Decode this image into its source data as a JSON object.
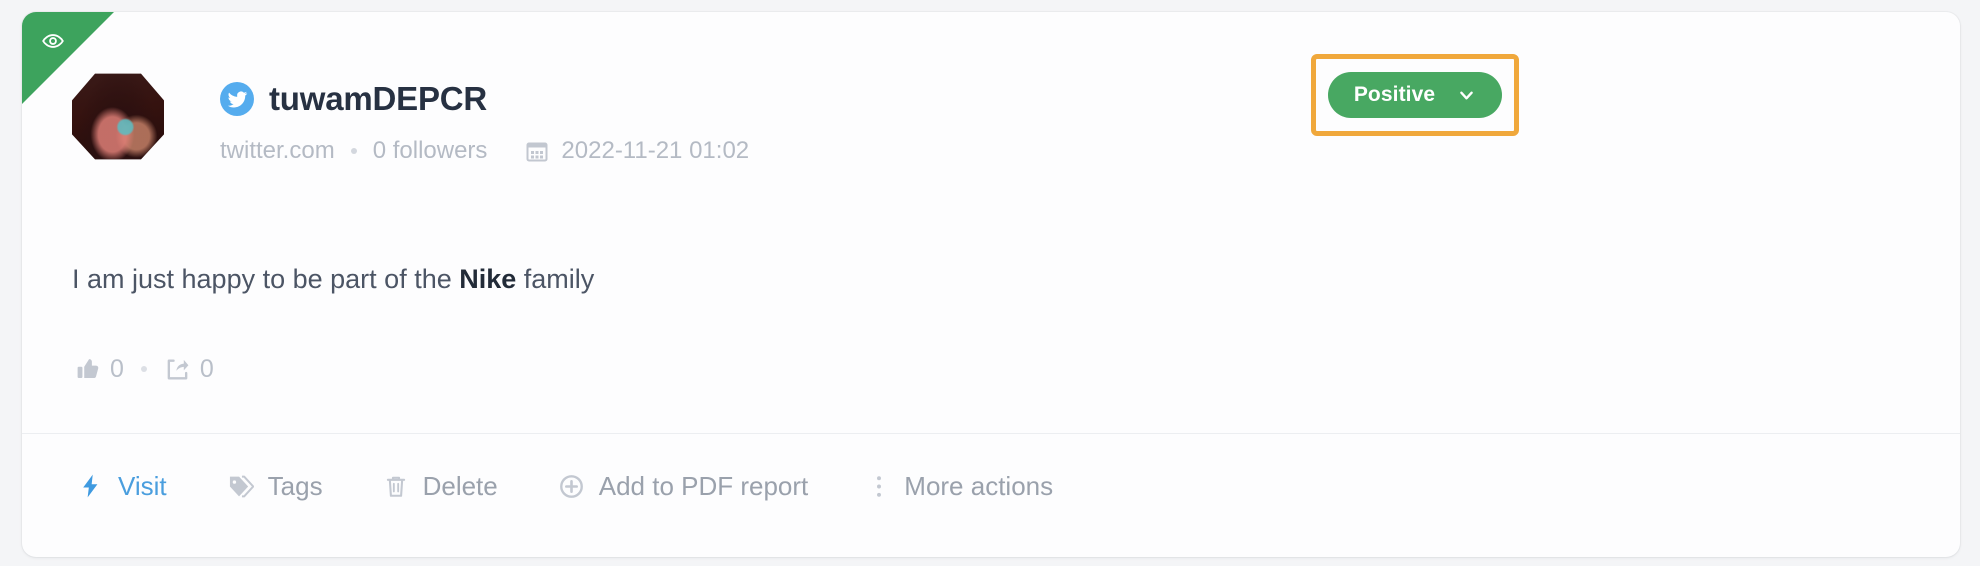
{
  "card": {
    "ribbon": {
      "icon": "eye-icon",
      "color": "#3da35d"
    },
    "author": {
      "username": "tuwamDEPCR",
      "network_icon": "twitter-icon",
      "domain": "twitter.com",
      "followers": "0 followers",
      "date_icon": "calendar-icon",
      "date": "2022-11-21 01:02"
    },
    "sentiment": {
      "label": "Positive",
      "color": "#48a862",
      "chevron_icon": "chevron-down-icon",
      "highlight_color": "#f0a83c"
    },
    "content": {
      "text_before": "I am just happy to be part of the ",
      "highlighted": "Nike",
      "text_after": " family"
    },
    "stats": [
      {
        "icon": "thumbs-up-icon",
        "value": "0"
      },
      {
        "icon": "share-icon",
        "value": "0"
      }
    ],
    "actions": [
      {
        "icon": "lightning-icon",
        "label": "Visit",
        "primary": true
      },
      {
        "icon": "tag-icon",
        "label": "Tags",
        "primary": false
      },
      {
        "icon": "trash-icon",
        "label": "Delete",
        "primary": false
      },
      {
        "icon": "plus-circle-icon",
        "label": "Add to PDF report",
        "primary": false
      },
      {
        "icon": "dots-vertical-icon",
        "label": "More actions",
        "primary": false
      }
    ]
  }
}
